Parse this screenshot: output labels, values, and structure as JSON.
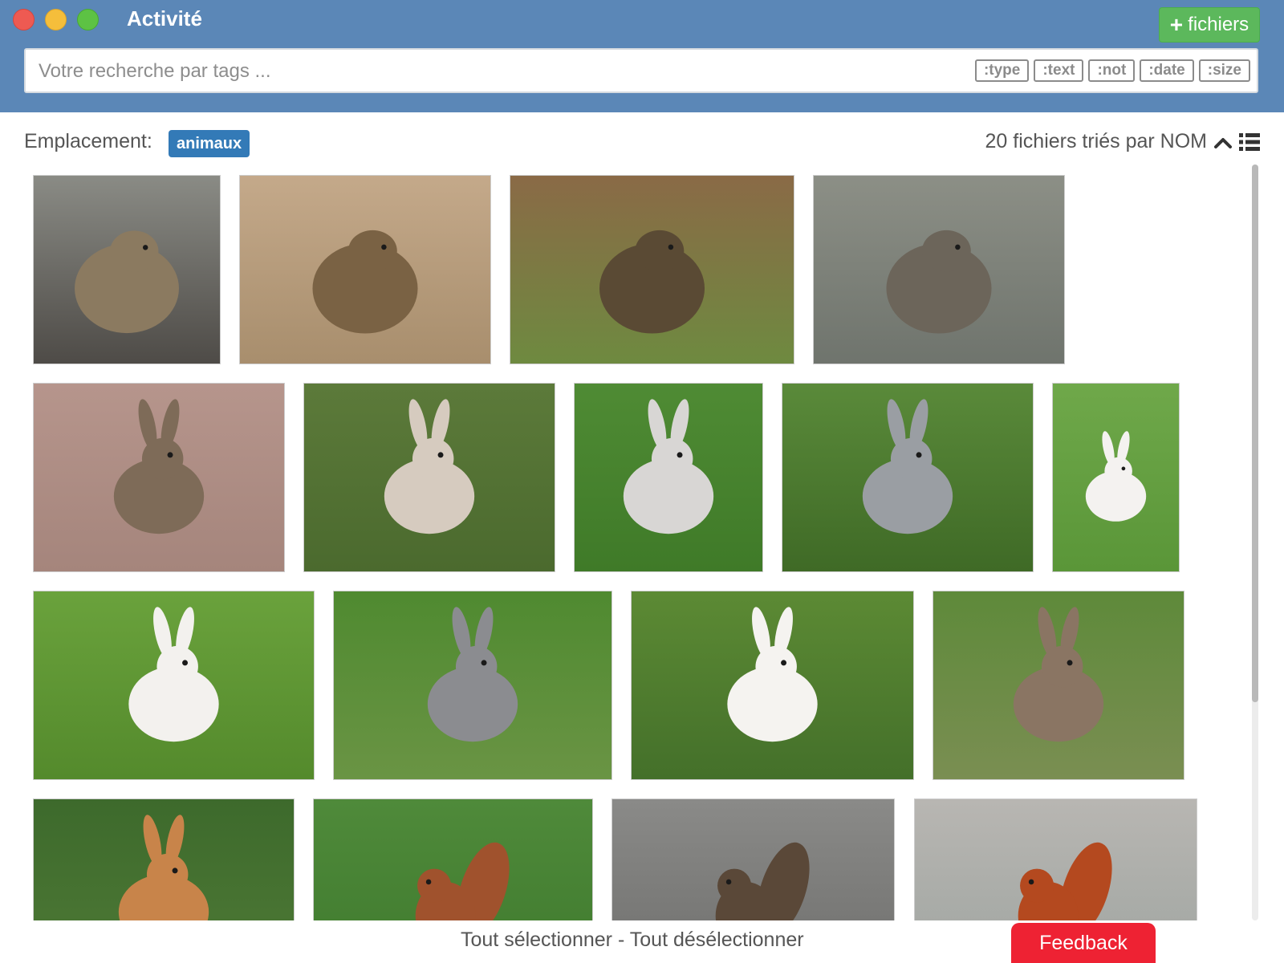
{
  "window": {
    "title": "Activité"
  },
  "toolbar": {
    "add_files_label": "fichiers"
  },
  "search": {
    "placeholder": "Votre recherche par tags ...",
    "filters": [
      ":type",
      ":text",
      ":not",
      ":date",
      ":size"
    ]
  },
  "location": {
    "label": "Emplacement:",
    "folder": "animaux"
  },
  "sort": {
    "summary": "20 fichiers triés par NOM"
  },
  "grid": {
    "photos": [
      {
        "subject": "marmot",
        "colors": [
          "#8a8b85",
          "#4e4b47"
        ],
        "body": "#8b7a60"
      },
      {
        "subject": "marmot",
        "colors": [
          "#c4a98a",
          "#a88e6d"
        ],
        "body": "#7a6244"
      },
      {
        "subject": "marmot",
        "colors": [
          "#8a6a46",
          "#6e8a40"
        ],
        "body": "#5a4a34"
      },
      {
        "subject": "marmot",
        "colors": [
          "#8c8f86",
          "#6f746d"
        ],
        "body": "#6c655a"
      },
      {
        "subject": "rabbit",
        "colors": [
          "#b6958c",
          "#a5857c"
        ],
        "body": "#7e6b58"
      },
      {
        "subject": "rabbit",
        "colors": [
          "#5c7a3a",
          "#4b6a2e"
        ],
        "body": "#d6cbbf"
      },
      {
        "subject": "rabbit",
        "colors": [
          "#4f8b34",
          "#3f7a28"
        ],
        "body": "#d8d6d4"
      },
      {
        "subject": "rabbit",
        "colors": [
          "#5a8a3a",
          "#3f6a26"
        ],
        "body": "#9a9ea3"
      },
      {
        "subject": "rabbit",
        "colors": [
          "#6fa84a",
          "#5a9638"
        ],
        "body": "#f4f2f0"
      },
      {
        "subject": "rabbit",
        "colors": [
          "#6aa23c",
          "#548a2c"
        ],
        "body": "#f3f1ee"
      },
      {
        "subject": "rabbit",
        "colors": [
          "#4f8a30",
          "#6a9444"
        ],
        "body": "#8b8c90"
      },
      {
        "subject": "rabbit",
        "colors": [
          "#5c8a34",
          "#44702a"
        ],
        "body": "#f5f3f0"
      },
      {
        "subject": "rabbit",
        "colors": [
          "#5e8a3a",
          "#7a8e52"
        ],
        "body": "#8a7563"
      },
      {
        "subject": "rabbit",
        "colors": [
          "#3d6a2c",
          "#4f7a36"
        ],
        "body": "#c8844a"
      },
      {
        "subject": "squirrel",
        "colors": [
          "#4f8a3a",
          "#3f7a2e"
        ],
        "body": "#a0522d"
      },
      {
        "subject": "squirrel",
        "colors": [
          "#8a8a88",
          "#6e6e6c"
        ],
        "body": "#5a4838"
      },
      {
        "subject": "squirrel",
        "colors": [
          "#b8b6b2",
          "#9ea4a0"
        ],
        "body": "#b4491f"
      }
    ]
  },
  "footer": {
    "select_links": "Tout sélectionner - Tout désélectionner",
    "feedback_label": "Feedback"
  }
}
